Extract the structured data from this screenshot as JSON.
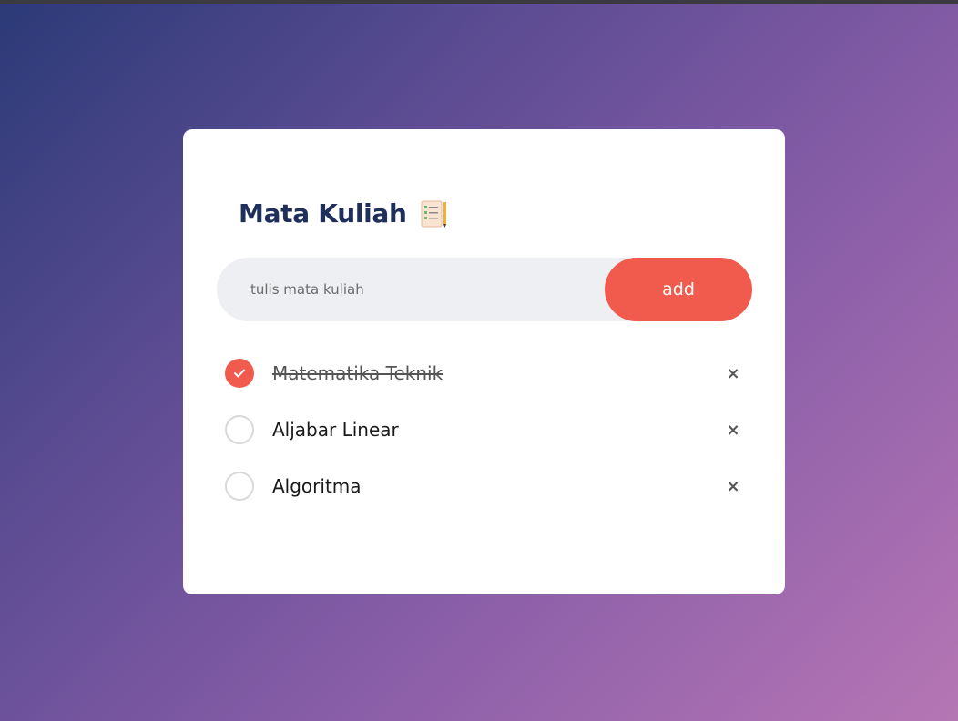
{
  "app": {
    "title": "Mata Kuliah",
    "title_icon": "notepad-icon"
  },
  "input": {
    "value": "",
    "placeholder": "tulis mata kuliah"
  },
  "add_button": {
    "label": "add"
  },
  "colors": {
    "accent": "#f15b4d",
    "title": "#1f2f5c",
    "input_bg": "#eeeff2"
  },
  "tasks": [
    {
      "label": "Matematika Teknik",
      "done": true,
      "delete_icon": "×"
    },
    {
      "label": "Aljabar Linear",
      "done": false,
      "delete_icon": "×"
    },
    {
      "label": "Algoritma",
      "done": false,
      "delete_icon": "×"
    }
  ]
}
